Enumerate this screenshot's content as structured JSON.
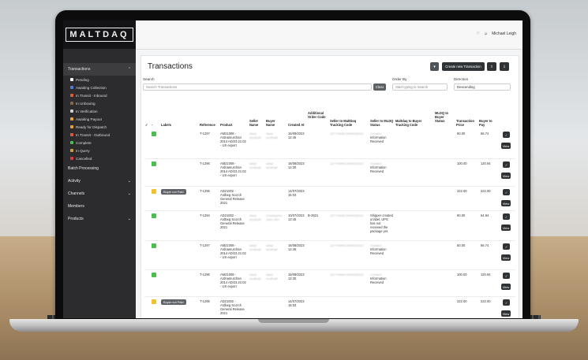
{
  "brand": {
    "logo_text": "MALTDAQ"
  },
  "topbar": {
    "user_name": "Michael Leigh",
    "bell_icon": "bell-icon",
    "user_icon": "user-icon"
  },
  "sidebar": {
    "transactions_label": "Transactions",
    "sub_items": [
      {
        "label": "Pending",
        "color": "#ffffff"
      },
      {
        "label": "Awaiting Collection",
        "color": "#4c7bd9"
      },
      {
        "label": "In Transit - Inbound",
        "color": "#e05a3a"
      },
      {
        "label": "In Unboxing",
        "color": "#8a6a45"
      },
      {
        "label": "In Verification",
        "color": "#d0d0d0"
      },
      {
        "label": "Awaiting Payout",
        "color": "#f0a13a"
      },
      {
        "label": "Ready for Dispatch",
        "color": "#e8a030"
      },
      {
        "label": "In Transit - Outbound",
        "color": "#e05a3a"
      },
      {
        "label": "Complete",
        "color": "#4bbf4b"
      },
      {
        "label": "In Query",
        "color": "#c9a13a"
      },
      {
        "label": "Cancelled",
        "color": "#e03a3a"
      }
    ],
    "sections": [
      {
        "label": "Batch Processing",
        "chevron": false
      },
      {
        "label": "Activity",
        "chevron": true
      },
      {
        "label": "Channels",
        "chevron": true
      },
      {
        "label": "Members",
        "chevron": false
      },
      {
        "label": "Products",
        "chevron": true
      }
    ]
  },
  "page": {
    "title": "Transactions",
    "create_button": "Create new Transaction",
    "search_label": "Search",
    "search_placeholder": "Search Transactions",
    "clear_button": "Clear",
    "order_by_label": "Order By",
    "order_by_placeholder": "Start typing to Search",
    "direction_label": "Direction",
    "direction_value": "Descending"
  },
  "table": {
    "headers": {
      "check": "✓",
      "dash": "-",
      "labels": "Labels",
      "reference": "Reference",
      "product": "Product",
      "seller_name": "Seller Name",
      "buyer_name": "Buyer Name",
      "created_at": "Created At",
      "order_code": "Additional Order Code",
      "seller_tracking": "Seller to MaltDaq Tracking Code",
      "seller_status": "Seller to MLDQ Status",
      "buyer_tracking": "Maltdaq to Buyer Tracking Code",
      "buyer_status": "MLDQ to Buyer Status",
      "price": "Transaction Price",
      "buyer_pay": "Buyer to Pay"
    },
    "view_label": "View",
    "check_label": "✓",
    "rows": [
      {
        "color": "#4bbf4b",
        "label": "",
        "ref": "T-1297",
        "product": "AM21008 - Ardnamurchan 2014 AD/23.21:02 - US export",
        "seller": "Ideal scotfoall",
        "buyer": "Ideal scotfoall",
        "created": "16/08/2023 12:46",
        "order_code": "",
        "tracking": "1ZYYW4ECRIDEEEDO",
        "status_pre": "Created",
        "status": "Information Received",
        "price": "50.00",
        "pay": "66.74"
      },
      {
        "color": "#4bbf4b",
        "label": "",
        "ref": "T-1296",
        "product": "AM21008 - Ardnamurchan 2014 AD/23.21:02 - US export",
        "seller": "Ideal scotfoall",
        "buyer": "Ideal scotfoall",
        "created": "16/08/2023 12:30",
        "order_code": "",
        "tracking": "1ZYYW4ECRIDEEEDO",
        "status_pre": "Created",
        "status": "Information Received",
        "price": "100.00",
        "pay": "120.94"
      },
      {
        "color": "#f2c12e",
        "label": "Buyer not Paid",
        "ref": "T-1295",
        "product": "AD21002 - Ardbeg Scorch General Release 2021",
        "seller": "",
        "buyer": "",
        "created": "14/07/2023 15:03",
        "order_code": "",
        "tracking": "",
        "status_pre": "",
        "status": "",
        "price": "222.00",
        "pay": "222.00"
      },
      {
        "color": "#4bbf4b",
        "label": "",
        "ref": "T-1294",
        "product": "AD21002 - Ardbeg Scorch General Release 2021",
        "seller": "Ideal scotfoall",
        "buyer": "Christopher John Hen",
        "created": "10/07/2023 13:45",
        "order_code": "B-2821",
        "tracking": "1ZYYW4ECRIDEEEDO",
        "status_pre": "",
        "status": "Shipper created a label, UPS has not received the package yet.",
        "price": "60.00",
        "pay": "64.94"
      },
      {
        "color": "#4bbf4b",
        "label": "",
        "ref": "T-1297",
        "product": "AM21008 - Ardnamurchan 2014 AD/23.21:02 - US export",
        "seller": "Ideal scotfoall",
        "buyer": "Ideal scotfoall",
        "created": "16/08/2023 12:46",
        "order_code": "",
        "tracking": "1ZYYW4ECRIDEEEDO",
        "status_pre": "Created",
        "status": "Information Received",
        "price": "50.00",
        "pay": "66.74"
      },
      {
        "color": "#4bbf4b",
        "label": "",
        "ref": "T-1296",
        "product": "AM21008 - Ardnamurchan 2014 AD/23.21:02 - US export",
        "seller": "Ideal scotfoall",
        "buyer": "Ideal scotfoall",
        "created": "16/08/2023 12:30",
        "order_code": "",
        "tracking": "1ZYYW4ECRIDEEEDO",
        "status_pre": "Created",
        "status": "Information Received",
        "price": "100.00",
        "pay": "120.94"
      },
      {
        "color": "#f2c12e",
        "label": "Buyer not Paid",
        "ref": "T-1295",
        "product": "AD21002 - Ardbeg Scorch General Release 2021",
        "seller": "",
        "buyer": "",
        "created": "14/07/2023 15:03",
        "order_code": "",
        "tracking": "",
        "status_pre": "",
        "status": "",
        "price": "222.00",
        "pay": "222.00"
      },
      {
        "color": "#4bbf4b",
        "label": "",
        "ref": "T-1294",
        "product": "AD21002 - Ardbeg Scorch General Release",
        "seller": "Ideal scotfoall",
        "buyer": "Christopher John Hen",
        "created": "10/07/2023 13:45",
        "order_code": "B-2821",
        "tracking": "1ZYYW4ECRIDEEEDO",
        "status_pre": "",
        "status": "Shipper created a label, UPS has not",
        "price": "50.00",
        "pay": "64.94"
      }
    ]
  }
}
